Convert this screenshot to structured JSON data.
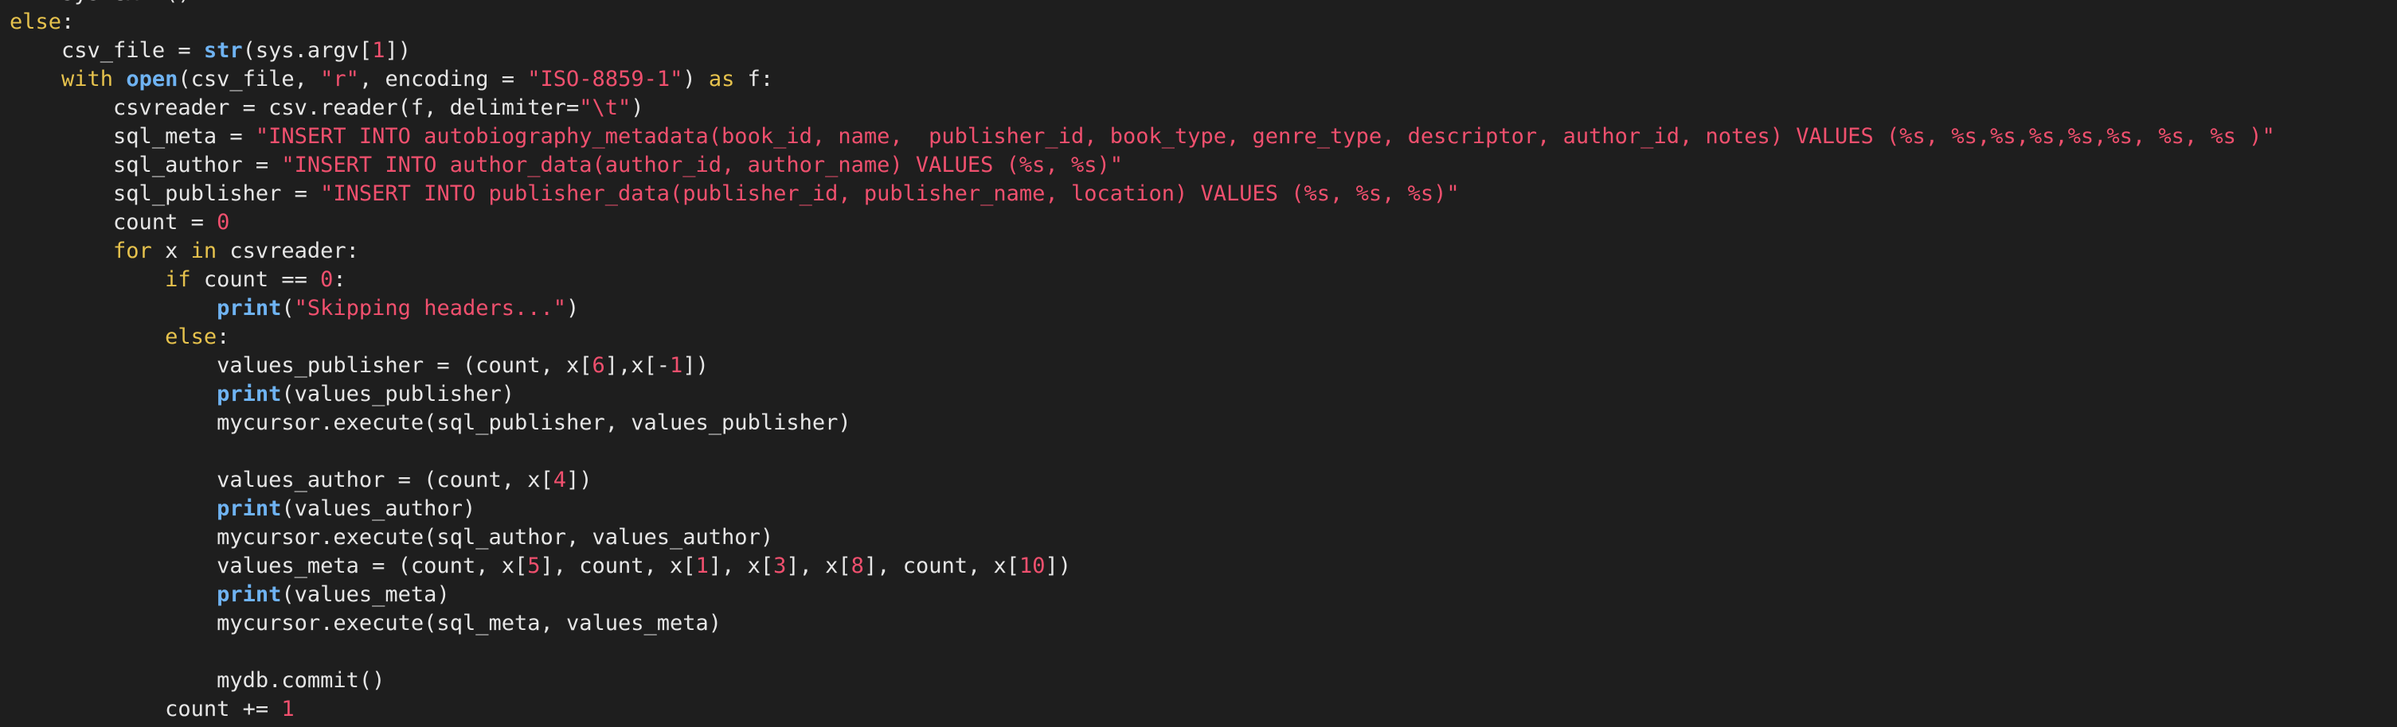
{
  "theme": {
    "background": "#1e1e1e",
    "text": "#e6e6e6",
    "keyword": "#e6c24d",
    "builtin": "#6fb3f2",
    "string": "#f0506e",
    "number": "#f0506e"
  },
  "code": {
    "lines": [
      {
        "indent": 1,
        "tokens": [
          {
            "t": "plain",
            "v": "sys.exit()"
          }
        ]
      },
      {
        "indent": 0,
        "tokens": [
          {
            "t": "kw",
            "v": "else"
          },
          {
            "t": "plain",
            "v": ":"
          }
        ]
      },
      {
        "indent": 1,
        "tokens": [
          {
            "t": "plain",
            "v": "csv_file = "
          },
          {
            "t": "fn",
            "v": "str"
          },
          {
            "t": "plain",
            "v": "(sys.argv["
          },
          {
            "t": "num",
            "v": "1"
          },
          {
            "t": "plain",
            "v": "])"
          }
        ]
      },
      {
        "indent": 1,
        "tokens": [
          {
            "t": "kw",
            "v": "with"
          },
          {
            "t": "plain",
            "v": " "
          },
          {
            "t": "fn",
            "v": "open"
          },
          {
            "t": "plain",
            "v": "(csv_file, "
          },
          {
            "t": "str",
            "v": "\"r\""
          },
          {
            "t": "plain",
            "v": ", encoding = "
          },
          {
            "t": "str",
            "v": "\"ISO-8859-1\""
          },
          {
            "t": "plain",
            "v": ") "
          },
          {
            "t": "kw",
            "v": "as"
          },
          {
            "t": "plain",
            "v": " f:"
          }
        ]
      },
      {
        "indent": 2,
        "tokens": [
          {
            "t": "plain",
            "v": "csvreader = csv.reader(f, delimiter="
          },
          {
            "t": "str",
            "v": "\"\\t\""
          },
          {
            "t": "plain",
            "v": ")"
          }
        ]
      },
      {
        "indent": 2,
        "tokens": [
          {
            "t": "plain",
            "v": "sql_meta = "
          },
          {
            "t": "str",
            "v": "\"INSERT INTO autobiography_metadata(book_id, name,  publisher_id, book_type, genre_type, descriptor, author_id, notes) VALUES (%s, %s,%s,%s,%s,%s, %s, %s )\""
          }
        ]
      },
      {
        "indent": 2,
        "tokens": [
          {
            "t": "plain",
            "v": "sql_author = "
          },
          {
            "t": "str",
            "v": "\"INSERT INTO author_data(author_id, author_name) VALUES (%s, %s)\""
          }
        ]
      },
      {
        "indent": 2,
        "tokens": [
          {
            "t": "plain",
            "v": "sql_publisher = "
          },
          {
            "t": "str",
            "v": "\"INSERT INTO publisher_data(publisher_id, publisher_name, location) VALUES (%s, %s, %s)\""
          }
        ]
      },
      {
        "indent": 2,
        "tokens": [
          {
            "t": "plain",
            "v": "count = "
          },
          {
            "t": "num",
            "v": "0"
          }
        ]
      },
      {
        "indent": 2,
        "tokens": [
          {
            "t": "kw",
            "v": "for"
          },
          {
            "t": "plain",
            "v": " x "
          },
          {
            "t": "kw",
            "v": "in"
          },
          {
            "t": "plain",
            "v": " csvreader:"
          }
        ]
      },
      {
        "indent": 3,
        "tokens": [
          {
            "t": "kw",
            "v": "if"
          },
          {
            "t": "plain",
            "v": " count == "
          },
          {
            "t": "num",
            "v": "0"
          },
          {
            "t": "plain",
            "v": ":"
          }
        ]
      },
      {
        "indent": 4,
        "tokens": [
          {
            "t": "fn",
            "v": "print"
          },
          {
            "t": "plain",
            "v": "("
          },
          {
            "t": "str",
            "v": "\"Skipping headers...\""
          },
          {
            "t": "plain",
            "v": ")"
          }
        ]
      },
      {
        "indent": 3,
        "tokens": [
          {
            "t": "kw",
            "v": "else"
          },
          {
            "t": "plain",
            "v": ":"
          }
        ]
      },
      {
        "indent": 4,
        "tokens": [
          {
            "t": "plain",
            "v": "values_publisher = (count, x["
          },
          {
            "t": "num",
            "v": "6"
          },
          {
            "t": "plain",
            "v": "],x[-"
          },
          {
            "t": "num",
            "v": "1"
          },
          {
            "t": "plain",
            "v": "])"
          }
        ]
      },
      {
        "indent": 4,
        "tokens": [
          {
            "t": "fn",
            "v": "print"
          },
          {
            "t": "plain",
            "v": "(values_publisher)"
          }
        ]
      },
      {
        "indent": 4,
        "tokens": [
          {
            "t": "plain",
            "v": "mycursor.execute(sql_publisher, values_publisher)"
          }
        ]
      },
      {
        "indent": 0,
        "tokens": []
      },
      {
        "indent": 4,
        "tokens": [
          {
            "t": "plain",
            "v": "values_author = (count, x["
          },
          {
            "t": "num",
            "v": "4"
          },
          {
            "t": "plain",
            "v": "])"
          }
        ]
      },
      {
        "indent": 4,
        "tokens": [
          {
            "t": "fn",
            "v": "print"
          },
          {
            "t": "plain",
            "v": "(values_author)"
          }
        ]
      },
      {
        "indent": 4,
        "tokens": [
          {
            "t": "plain",
            "v": "mycursor.execute(sql_author, values_author)"
          }
        ]
      },
      {
        "indent": 4,
        "tokens": [
          {
            "t": "plain",
            "v": "values_meta = (count, x["
          },
          {
            "t": "num",
            "v": "5"
          },
          {
            "t": "plain",
            "v": "], count, x["
          },
          {
            "t": "num",
            "v": "1"
          },
          {
            "t": "plain",
            "v": "], x["
          },
          {
            "t": "num",
            "v": "3"
          },
          {
            "t": "plain",
            "v": "], x["
          },
          {
            "t": "num",
            "v": "8"
          },
          {
            "t": "plain",
            "v": "], count, x["
          },
          {
            "t": "num",
            "v": "10"
          },
          {
            "t": "plain",
            "v": "])"
          }
        ]
      },
      {
        "indent": 4,
        "tokens": [
          {
            "t": "fn",
            "v": "print"
          },
          {
            "t": "plain",
            "v": "(values_meta)"
          }
        ]
      },
      {
        "indent": 4,
        "tokens": [
          {
            "t": "plain",
            "v": "mycursor.execute(sql_meta, values_meta)"
          }
        ]
      },
      {
        "indent": 0,
        "tokens": []
      },
      {
        "indent": 4,
        "tokens": [
          {
            "t": "plain",
            "v": "mydb.commit()"
          }
        ]
      },
      {
        "indent": 3,
        "tokens": [
          {
            "t": "plain",
            "v": "count += "
          },
          {
            "t": "num",
            "v": "1"
          }
        ]
      }
    ]
  }
}
